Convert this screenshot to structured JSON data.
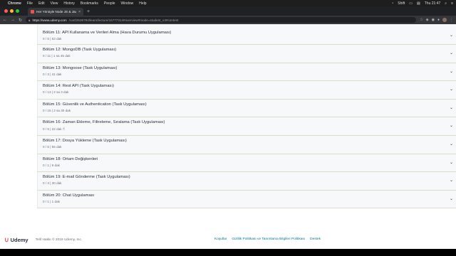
{
  "menubar": {
    "apple": "",
    "items": [
      "Chrome",
      "File",
      "Edit",
      "View",
      "History",
      "Bookmarks",
      "People",
      "Window",
      "Help"
    ],
    "status_input": "Shift",
    "status_time": "Thu 21:47"
  },
  "browser": {
    "tab_title": "Her Yönüyle Node JS & Javas",
    "tab_close": "×",
    "new_tab": "+",
    "url_host": "https://www.udemy.com",
    "url_path": "/cart/2536784/learn/lecture/15777314#overview#mode=student_v4#content",
    "traffic_colors": [
      "#ff5f57",
      "#febc2e",
      "#28c840"
    ]
  },
  "sections": [
    {
      "title": "Bölüm 11: API Kullanama ve Verileri Alma (Hava Durumu Uygulaması)",
      "meta": "0 / 5  |  53 dak"
    },
    {
      "title": "Bölüm 12: MongoDB (Task Uygulaması)",
      "meta": "0 / 11  |  1 sa 45 dak"
    },
    {
      "title": "Bölüm 13: Mongoose (Task Uygulaması)",
      "meta": "0 / 3  |  41 dak"
    },
    {
      "title": "Bölüm 14: Rest API (Task Uygulaması)",
      "meta": "0 / 13  |  2 sa 3 dak"
    },
    {
      "title": "Bölüm 15: Güvenlik ve Authentication (Task Uygulaması)",
      "meta": "0 / 15  |  2 sa 30 dak"
    },
    {
      "title": "Bölüm 16: Zaman Ekleme, Filtreleme, Sıralama (Task Uygulaması)",
      "meta": "0 / 5  |  22 dak"
    },
    {
      "title": "Bölüm 17: Dosya Yükleme (Task Uygulaması)",
      "meta": "0 / 5  |  55 dak"
    },
    {
      "title": "Bölüm 18: Ortam Değişkenleri",
      "meta": "0 / 1  |  9 dak"
    },
    {
      "title": "Bölüm 19: E-mail Gönderme (Task Uygulaması)",
      "meta": "0 / 3  |  30 dak"
    },
    {
      "title": "Bölüm 20: Chat Uygulaması",
      "meta": "0 / 1  |  1 dak"
    }
  ],
  "footer": {
    "logo_text": "Udemy",
    "copyright": "Telif Hakkı © 2019 Udemy, Inc.",
    "links": [
      "Koşullar",
      "Gizlilik Politikası ve Tanımlama Bilgileri Politikası",
      "Destek"
    ]
  },
  "colors": {
    "brand": "#ec5252",
    "link": "#007791",
    "section_bg": "#f7f8fa"
  }
}
